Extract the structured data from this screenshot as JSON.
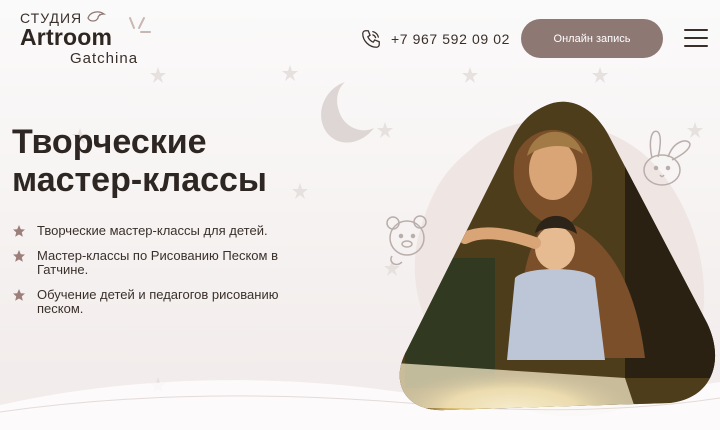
{
  "header": {
    "logo": {
      "studio": "СТУДИЯ",
      "name": "Artroom",
      "city": "Gatchina"
    },
    "phone": "+7 967 592 09 02",
    "cta_label": "Онлайн запись",
    "icons": {
      "phone": "phone-icon",
      "menu": "hamburger-menu-icon"
    }
  },
  "hero": {
    "title_line1": "Творческие",
    "title_line2": "мастер-классы",
    "bullets": [
      "Творческие мастер-классы для детей.",
      "Мастер-классы по Рисованию Песком в Гатчине.",
      "Обучение детей и педагогов рисованию песком."
    ]
  },
  "colors": {
    "accent": "#8d7873",
    "text": "#2e2622",
    "background": "#f6f2f1",
    "bullet_star": "#9d7f7a"
  }
}
